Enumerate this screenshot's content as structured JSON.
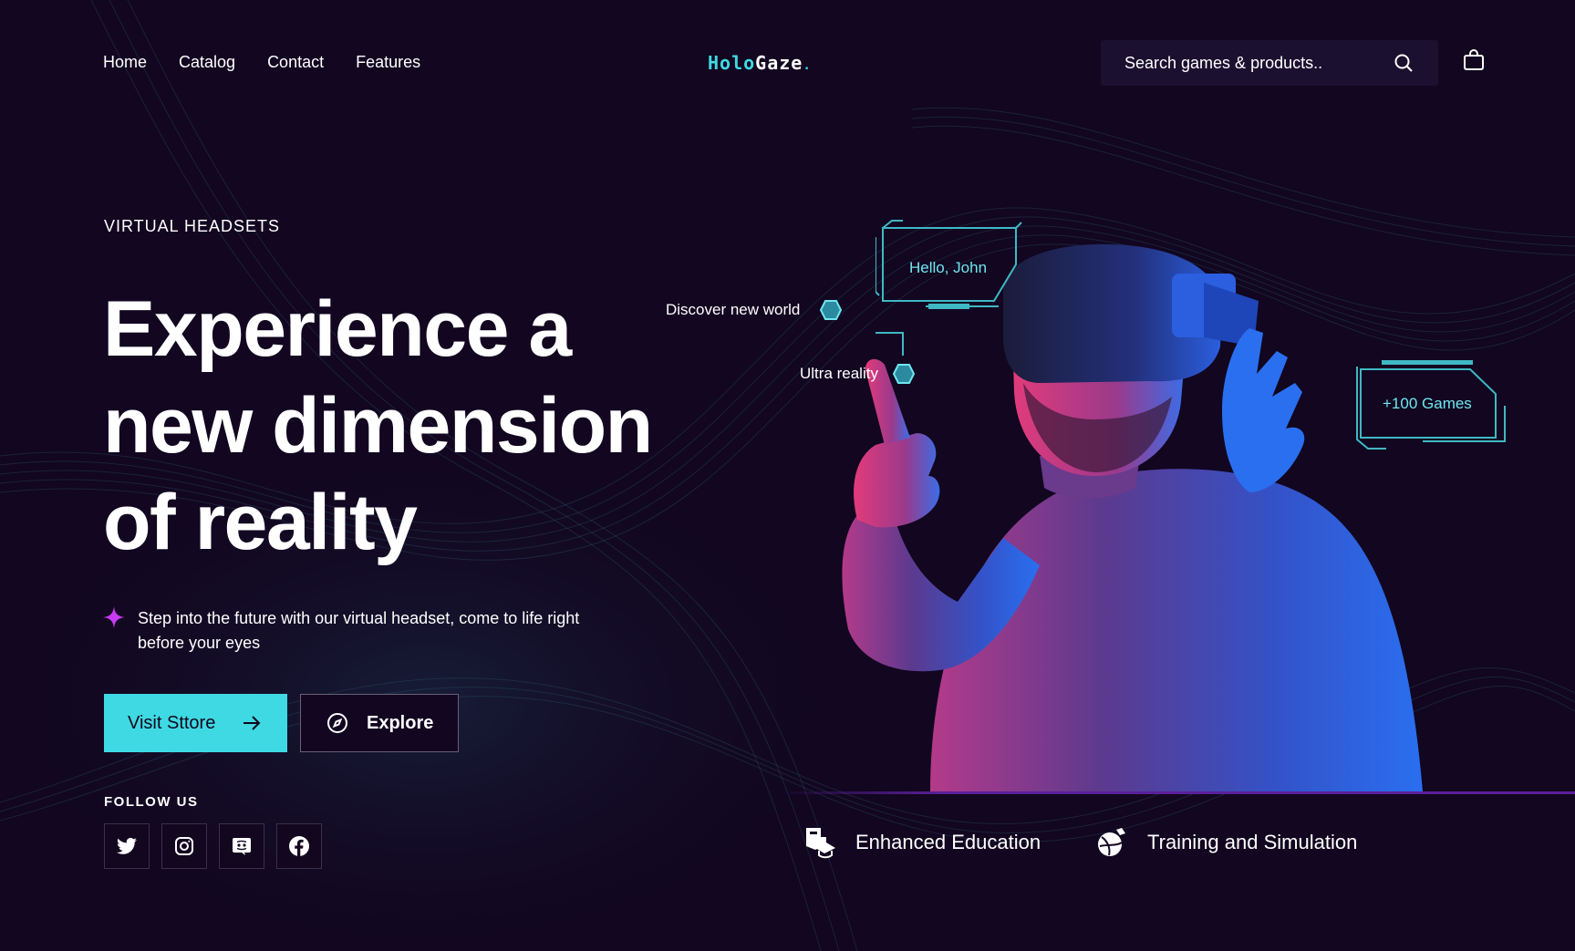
{
  "nav": {
    "links": [
      "Home",
      "Catalog",
      "Contact",
      "Features"
    ]
  },
  "logo": {
    "part1": "Holo",
    "part2": "Gaze",
    "dot": "."
  },
  "search": {
    "placeholder": "Search games & products.."
  },
  "hero": {
    "eyebrow": "VIRTUAL HEADSETS",
    "headline": [
      "Experience a",
      "new dimension",
      "of reality"
    ],
    "description": "Step into the future with our virtual headset, come to life right before your eyes",
    "primary_button": "Visit Sttore",
    "secondary_button": "Explore"
  },
  "follow": {
    "label": "FOLLOW US",
    "networks": [
      "twitter-icon",
      "instagram-icon",
      "discord-icon",
      "facebook-icon"
    ]
  },
  "hud": {
    "greeting": "Hello, John",
    "discover": "Discover new world",
    "ultra": "Ultra reality",
    "games": "+100 Games"
  },
  "features": [
    {
      "label": "Enhanced Education",
      "icon": "education-icon"
    },
    {
      "label": "Training and Simulation",
      "icon": "training-icon"
    }
  ],
  "colors": {
    "background": "#120620",
    "accent": "#3fd9e3",
    "spark": "#c73cf0",
    "divider": "#5a1f9a"
  }
}
